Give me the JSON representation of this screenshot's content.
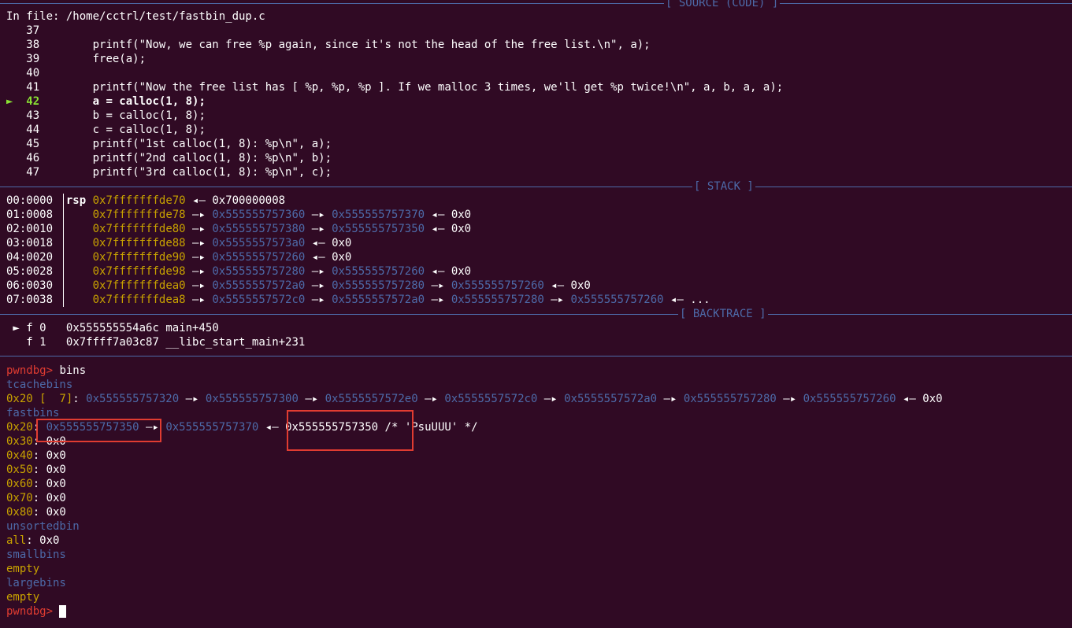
{
  "sections": {
    "source": "[ SOURCE (CODE) ]",
    "stack": "[ STACK ]",
    "backtrace": "[ BACKTRACE ]"
  },
  "source": {
    "file_line": "In file: /home/cctrl/test/fastbin_dup.c",
    "lines": [
      {
        "no": "37",
        "code": ""
      },
      {
        "no": "38",
        "code": "printf(\"Now, we can free %p again, since it's not the head of the free list.\\n\", a);"
      },
      {
        "no": "39",
        "code": "free(a);"
      },
      {
        "no": "40",
        "code": ""
      },
      {
        "no": "41",
        "code": "printf(\"Now the free list has [ %p, %p, %p ]. If we malloc 3 times, we'll get %p twice!\\n\", a, b, a, a);"
      },
      {
        "no": "42",
        "code": "a = calloc(1, 8);"
      },
      {
        "no": "43",
        "code": "b = calloc(1, 8);"
      },
      {
        "no": "44",
        "code": "c = calloc(1, 8);"
      },
      {
        "no": "45",
        "code": "printf(\"1st calloc(1, 8): %p\\n\", a);"
      },
      {
        "no": "46",
        "code": "printf(\"2nd calloc(1, 8): %p\\n\", b);"
      },
      {
        "no": "47",
        "code": "printf(\"3rd calloc(1, 8): %p\\n\", c);"
      }
    ],
    "current_marker": "►"
  },
  "stack": [
    {
      "off": "00:0000",
      "reg": "rsp",
      "addr": "0x7fffffffde70",
      "chain": [
        {
          "t": "0x700000008",
          "c": "w",
          "a": "←"
        }
      ]
    },
    {
      "off": "01:0008",
      "reg": "",
      "addr": "0x7fffffffde78",
      "chain": [
        {
          "t": "0x555555757360",
          "c": "b",
          "a": "→"
        },
        {
          "t": "0x555555757370",
          "c": "b",
          "a": "→"
        },
        {
          "t": "0x0",
          "c": "w",
          "a": "←"
        }
      ]
    },
    {
      "off": "02:0010",
      "reg": "",
      "addr": "0x7fffffffde80",
      "chain": [
        {
          "t": "0x555555757380",
          "c": "b",
          "a": "→"
        },
        {
          "t": "0x555555757350",
          "c": "b",
          "a": "→"
        },
        {
          "t": "0x0",
          "c": "w",
          "a": "←"
        }
      ]
    },
    {
      "off": "03:0018",
      "reg": "",
      "addr": "0x7fffffffde88",
      "chain": [
        {
          "t": "0x5555557573a0",
          "c": "b",
          "a": "→"
        },
        {
          "t": "0x0",
          "c": "w",
          "a": "←"
        }
      ]
    },
    {
      "off": "04:0020",
      "reg": "",
      "addr": "0x7fffffffde90",
      "chain": [
        {
          "t": "0x555555757260",
          "c": "b",
          "a": "→"
        },
        {
          "t": "0x0",
          "c": "w",
          "a": "←"
        }
      ]
    },
    {
      "off": "05:0028",
      "reg": "",
      "addr": "0x7fffffffde98",
      "chain": [
        {
          "t": "0x555555757280",
          "c": "b",
          "a": "→"
        },
        {
          "t": "0x555555757260",
          "c": "b",
          "a": "→"
        },
        {
          "t": "0x0",
          "c": "w",
          "a": "←"
        }
      ]
    },
    {
      "off": "06:0030",
      "reg": "",
      "addr": "0x7fffffffdea0",
      "chain": [
        {
          "t": "0x5555557572a0",
          "c": "b",
          "a": "→"
        },
        {
          "t": "0x555555757280",
          "c": "b",
          "a": "→"
        },
        {
          "t": "0x555555757260",
          "c": "b",
          "a": "→"
        },
        {
          "t": "0x0",
          "c": "w",
          "a": "←"
        }
      ]
    },
    {
      "off": "07:0038",
      "reg": "",
      "addr": "0x7fffffffdea8",
      "chain": [
        {
          "t": "0x5555557572c0",
          "c": "b",
          "a": "→"
        },
        {
          "t": "0x5555557572a0",
          "c": "b",
          "a": "→"
        },
        {
          "t": "0x555555757280",
          "c": "b",
          "a": "→"
        },
        {
          "t": "0x555555757260",
          "c": "b",
          "a": "→"
        },
        {
          "t": "...",
          "c": "w",
          "a": "←"
        }
      ]
    }
  ],
  "backtrace": [
    {
      "mark": "►",
      "frame": "f 0",
      "addr": "0x555555554a6c",
      "sym": "main+450"
    },
    {
      "mark": "",
      "frame": "f 1",
      "addr": "0x7ffff7a03c87",
      "sym": "__libc_start_main+231"
    }
  ],
  "prompt": "pwndbg>",
  "command": "bins",
  "bins": {
    "tcache_label": "tcachebins",
    "tcache_key": "0x20 [  7]",
    "tcache_chain": [
      "0x555555757320",
      "0x555555757300",
      "0x5555557572e0",
      "0x5555557572c0",
      "0x5555557572a0",
      "0x555555757280",
      "0x555555757260"
    ],
    "tcache_end": "0x0",
    "fastbins_label": "fastbins",
    "fast_0x20": {
      "key": "0x20",
      "a1": "0x555555757350",
      "a2": "0x555555757370",
      "a3": "0x555555757350",
      "comment": "/* 'PsuUUU' */"
    },
    "fast_rest": [
      {
        "key": "0x30",
        "val": "0x0"
      },
      {
        "key": "0x40",
        "val": "0x0"
      },
      {
        "key": "0x50",
        "val": "0x0"
      },
      {
        "key": "0x60",
        "val": "0x0"
      },
      {
        "key": "0x70",
        "val": "0x0"
      },
      {
        "key": "0x80",
        "val": "0x0"
      }
    ],
    "unsorted_label": "unsortedbin",
    "unsorted_all_key": "all",
    "unsorted_all_val": "0x0",
    "small_label": "smallbins",
    "small_val": "empty",
    "large_label": "largebins",
    "large_val": "empty"
  }
}
